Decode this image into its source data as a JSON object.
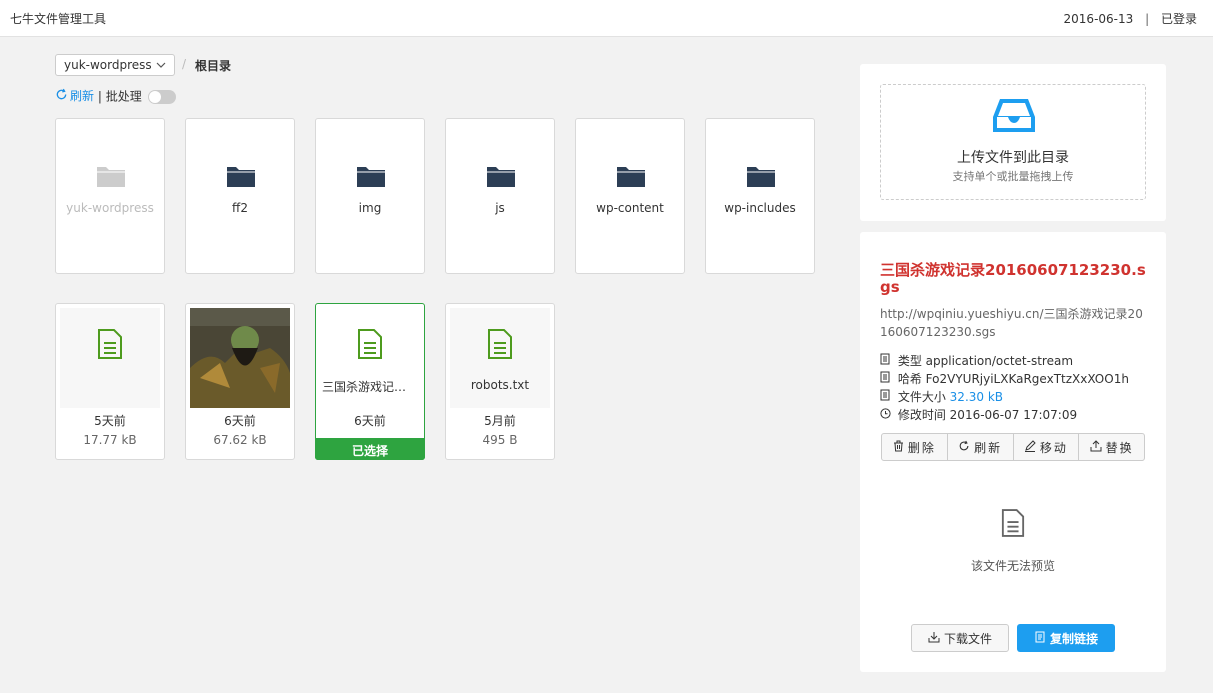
{
  "header": {
    "app_title": "七牛文件管理工具",
    "date": "2016-06-13",
    "separator": "|",
    "login_status": "已登录"
  },
  "toolbar": {
    "bucket_selected": "yuk-wordpress",
    "breadcrumb_sep": "/",
    "breadcrumb_root": "根目录",
    "refresh_label": "刷新",
    "divider": "|",
    "batch_label": "批处理",
    "batch_enabled": false
  },
  "folders": [
    {
      "name": "yuk-wordpress",
      "disabled": true
    },
    {
      "name": "ff2",
      "disabled": false
    },
    {
      "name": "img",
      "disabled": false
    },
    {
      "name": "js",
      "disabled": false
    },
    {
      "name": "wp-content",
      "disabled": false
    },
    {
      "name": "wp-includes",
      "disabled": false
    }
  ],
  "files": [
    {
      "thumb_type": "doc",
      "name": "",
      "age": "5天前",
      "size": "17.77 kB"
    },
    {
      "thumb_type": "image",
      "name": "",
      "age": "6天前",
      "size": "67.62 kB"
    },
    {
      "thumb_type": "doc",
      "name": "三国杀游戏记录20160607123230.sgs",
      "age": "6天前",
      "size": "",
      "selected_label": "已选择"
    },
    {
      "thumb_type": "doc",
      "name": "robots.txt",
      "age": "5月前",
      "size": "495 B"
    }
  ],
  "upload": {
    "title": "上传文件到此目录",
    "subtitle": "支持单个或批量拖拽上传"
  },
  "detail": {
    "title": "三国杀游戏记录20160607123230.sgs",
    "url": "http://wpqiniu.yueshiyu.cn/三国杀游戏记录20160607123230.sgs",
    "type_label": "类型",
    "type_value": "application/octet-stream",
    "hash_label": "哈希",
    "hash_value": "Fo2VYURjyiLXKaRgexTtzXxXOO1h",
    "size_label": "文件大小",
    "size_value": "32.30 kB",
    "mtime_label": "修改时间",
    "mtime_value": "2016-06-07 17:07:09",
    "actions": {
      "delete": "删除",
      "refresh": "刷新",
      "move": "移动",
      "replace": "替换"
    },
    "no_preview": "该文件无法预览",
    "download_label": "下载文件",
    "copy_label": "复制链接"
  },
  "colors": {
    "accent_blue": "#1d9ef0",
    "selected_green": "#2ea440",
    "title_red": "#d0332f",
    "folder_dark": "#2c3e55"
  }
}
